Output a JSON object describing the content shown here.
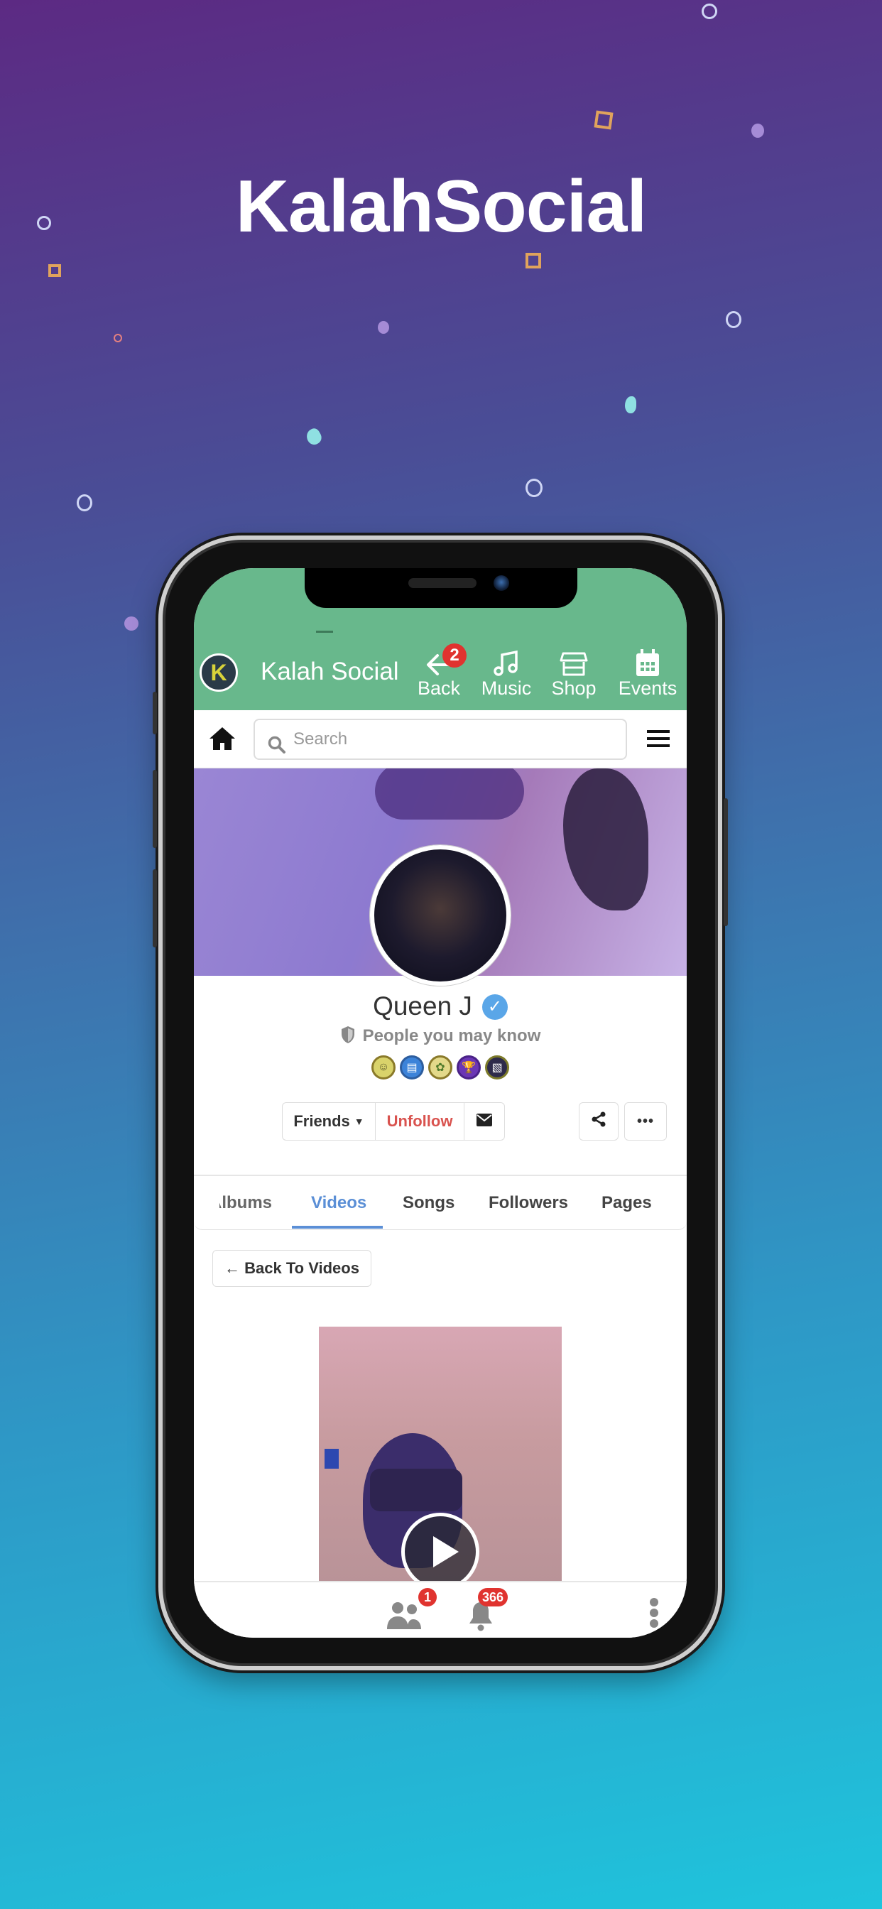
{
  "promo": {
    "title": "KalahSocial"
  },
  "app": {
    "title": "Kalah Social",
    "logo_letter": "K",
    "header_nav": [
      {
        "label": "Back",
        "icon": "arrow-left-icon",
        "badge": "2"
      },
      {
        "label": "Music",
        "icon": "music-icon"
      },
      {
        "label": "Shop",
        "icon": "store-icon"
      },
      {
        "label": "Events",
        "icon": "calendar-icon"
      }
    ],
    "search": {
      "placeholder": "Search"
    }
  },
  "profile": {
    "name": "Queen J",
    "verified": true,
    "relation": "People you may know",
    "badges": [
      "face-badge",
      "notebook-badge",
      "flower-badge",
      "trophy-badge",
      "photo-badge"
    ],
    "actions": {
      "friends": "Friends",
      "unfollow": "Unfollow"
    },
    "accent_unfollow": "#d9534f"
  },
  "tabs": {
    "items": [
      "Albums",
      "Videos",
      "Songs",
      "Followers",
      "Pages"
    ],
    "active": "Videos",
    "accent": "#5b8fd6"
  },
  "content": {
    "back_button": "Back To Videos"
  },
  "bottom_nav": {
    "friends_badge": "1",
    "notifications_badge": "366"
  },
  "colors": {
    "header_green": "#68b88c",
    "badge_red": "#e0332f"
  }
}
